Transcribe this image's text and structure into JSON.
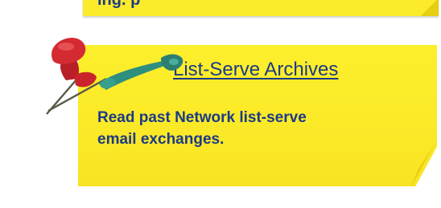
{
  "top_note": {
    "partial_text": "ing. p"
  },
  "card": {
    "title": "List-Serve Archives",
    "description": "Read past Network list-serve email exchanges."
  },
  "icons": {
    "pins": "push-pin-icon"
  },
  "colors": {
    "note_yellow": "#fbeb2a",
    "text_blue": "#1c3a87",
    "pin_red": "#c9242b",
    "pin_teal": "#2f8f7f"
  }
}
